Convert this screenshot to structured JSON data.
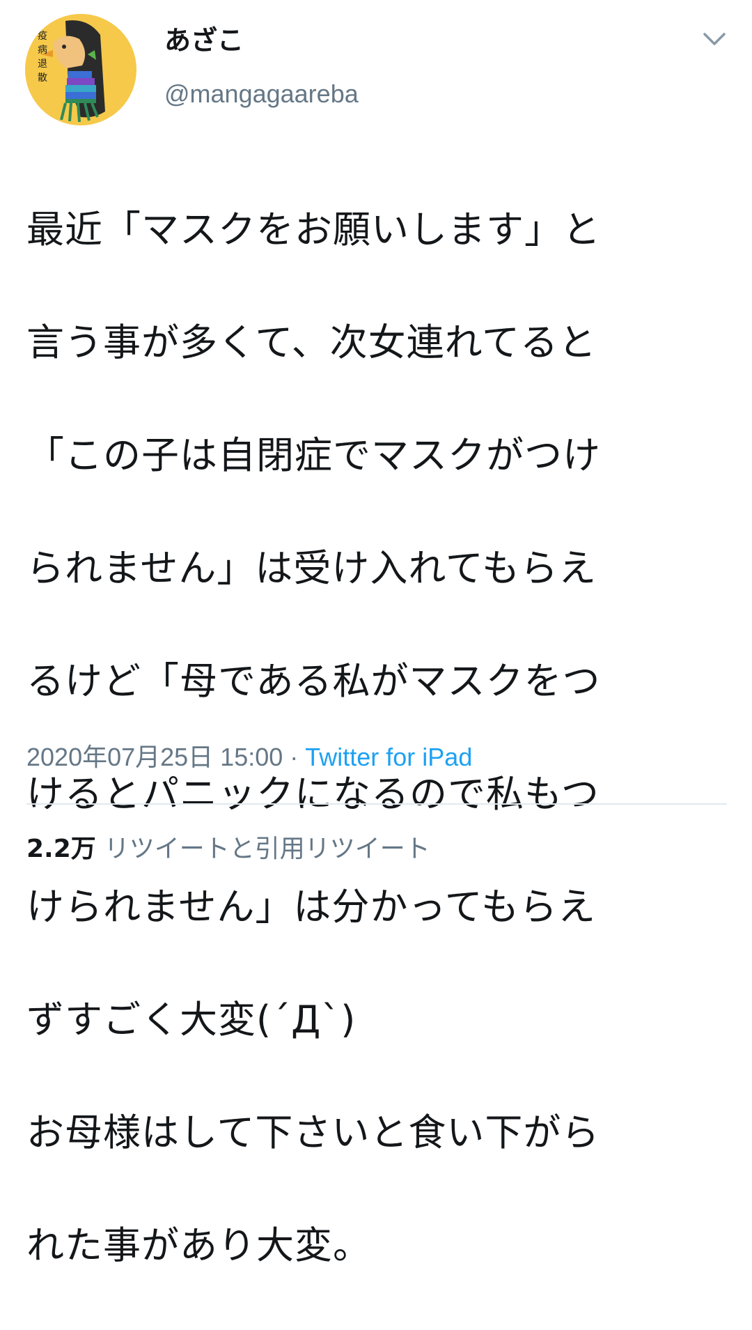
{
  "user": {
    "display_name": "あざこ",
    "handle": "@mangagaareba",
    "avatar_text": "疫病退散",
    "avatar_bg": "#f6c94a"
  },
  "tweet": {
    "text_lines": [
      "最近「マスクをお願いします」と",
      "言う事が多くて、次女連れてると",
      "「この子は自閉症でマスクがつけ",
      "られません」は受け入れてもらえ",
      "るけど「母である私がマスクをつ",
      "けるとパニックになるので私もつ",
      "けられません」は分かってもらえ",
      "ずすごく大変(´Д`)",
      "お母様はして下さいと食い下がら",
      "れた事があり大変。"
    ],
    "timestamp": "2020年07月25日 15:00",
    "separator": "·",
    "source": "Twitter for iPad"
  },
  "stats": {
    "count": "2.2万",
    "label": "リツイートと引用リツイート"
  },
  "icons": {
    "menu": "chevron-down-icon",
    "avatar": "avatar-image"
  },
  "colors": {
    "text": "#14171a",
    "secondary": "#657786",
    "link": "#1da1f2",
    "divider": "#e1e8ed"
  }
}
